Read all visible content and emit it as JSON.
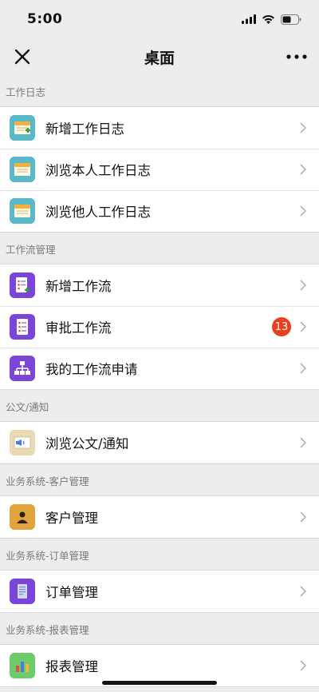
{
  "status": {
    "time": "5:00"
  },
  "nav": {
    "title": "桌面"
  },
  "sections": [
    {
      "header": "工作日志",
      "items": [
        {
          "label": "新增工作日志"
        },
        {
          "label": "浏览本人工作日志"
        },
        {
          "label": "浏览他人工作日志"
        }
      ]
    },
    {
      "header": "工作流管理",
      "items": [
        {
          "label": "新增工作流"
        },
        {
          "label": "审批工作流",
          "badge": "13"
        },
        {
          "label": "我的工作流申请"
        }
      ]
    },
    {
      "header": "公文/通知",
      "items": [
        {
          "label": "浏览公文/通知"
        }
      ]
    },
    {
      "header": "业务系统-客户管理",
      "items": [
        {
          "label": "客户管理"
        }
      ]
    },
    {
      "header": "业务系统-订单管理",
      "items": [
        {
          "label": "订单管理"
        }
      ]
    },
    {
      "header": "业务系统-报表管理",
      "items": [
        {
          "label": "报表管理"
        }
      ]
    }
  ],
  "colors": {
    "teal_icon": "#5bb8c8",
    "purple_icon": "#7b46d8",
    "beige_icon": "#ead9b5",
    "orange_icon": "#e3a33c",
    "green_icon": "#6ccc6a",
    "badge": "#e8401c"
  }
}
